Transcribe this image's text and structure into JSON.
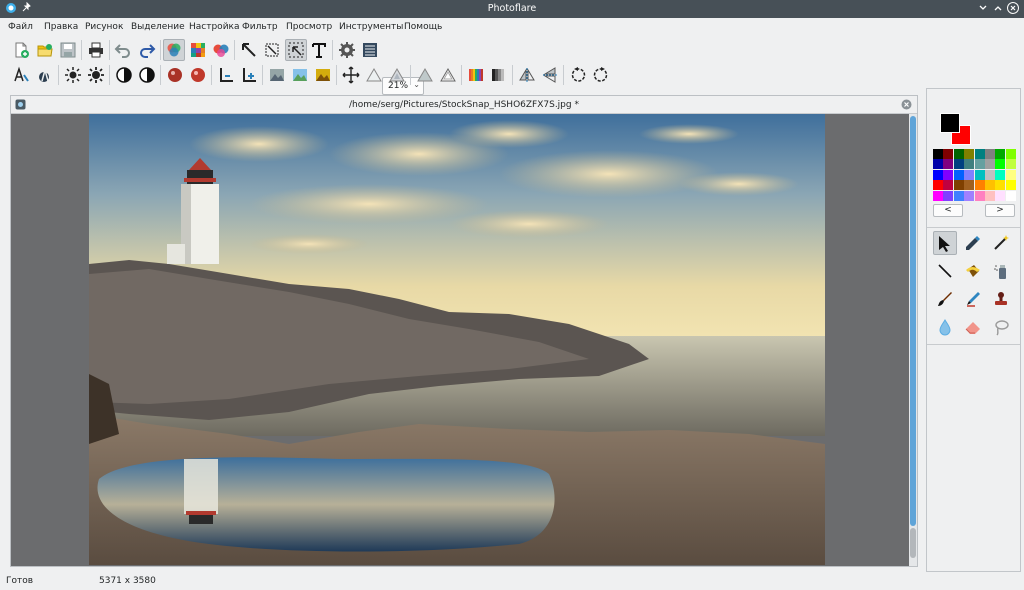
{
  "window": {
    "title": "Photoflare"
  },
  "menu": [
    "Файл",
    "Правка",
    "Рисунок",
    "Выделение",
    "Настройка",
    "Фильтр",
    "Просмотр",
    "Инструменты",
    "Помощь"
  ],
  "toolbar": {
    "zoom_value": "21%"
  },
  "document": {
    "path": "/home/serg/Pictures/StockSnap_HSHO6ZFX7S.jpg *"
  },
  "status": {
    "text": "Готов",
    "dimensions": "5371 x 3580"
  },
  "palette": {
    "foreground": "#000000",
    "background": "#ff0000",
    "colors": [
      "#000000",
      "#800000",
      "#006400",
      "#808000",
      "#008080",
      "#808080",
      "#00aa00",
      "#80ff00",
      "#0000aa",
      "#800080",
      "#004080",
      "#408080",
      "#66a0a0",
      "#a0a0a0",
      "#00ff00",
      "#c0ff40",
      "#0000ff",
      "#8000ff",
      "#0060ff",
      "#8080ff",
      "#00c0c0",
      "#c0c0c0",
      "#00ffc0",
      "#ffff80",
      "#ff0000",
      "#c00040",
      "#804000",
      "#a06020",
      "#ff8000",
      "#ffc000",
      "#ffe000",
      "#ffff00",
      "#ff00ff",
      "#8040ff",
      "#4080ff",
      "#a080ff",
      "#ff80c0",
      "#ffc0c0",
      "#ffe0ff",
      "#ffffff"
    ],
    "prev_label": "<",
    "next_label": ">"
  }
}
